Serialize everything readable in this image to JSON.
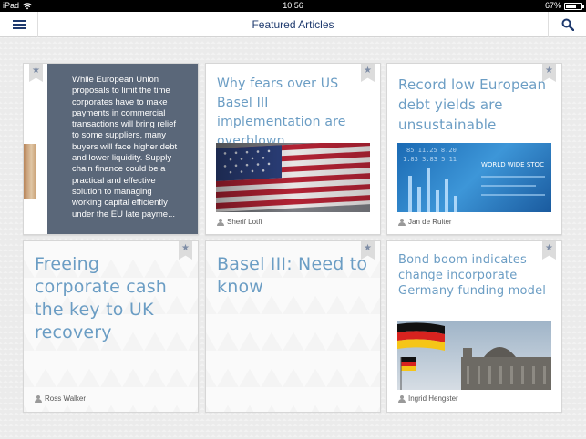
{
  "status": {
    "device": "iPad",
    "time": "10:56",
    "battery": "67%",
    "battery_level": 0.67
  },
  "header": {
    "title": "Featured Articles",
    "menu_icon": "hamburger-icon",
    "search_icon": "search-icon"
  },
  "articles": [
    {
      "summary": "While European Union proposals to limit the time corporates have to make payments in commercial transactions will bring relief to some suppliers, many buyers will face higher debt and lower liquidity. Supply chain finance could be a practical and effective solution to managing working capital efficiently under the EU late payme..."
    },
    {
      "title": "Why fears over US Basel III implementation are overblown",
      "author": "Sherif Lotfi",
      "image": "us-flag"
    },
    {
      "title": "Record low European debt yields are unsustainable",
      "author": "Jan de Ruiter",
      "image": "stock-ticker"
    },
    {
      "title": "Freeing corporate cash the key to UK recovery",
      "author": "Ross Walker"
    },
    {
      "title": "Basel III: Need to know"
    },
    {
      "title": "Bond boom indicates change incorporate Germany funding model",
      "author": "Ingrid Hengster",
      "image": "german-flag-reichstag"
    }
  ],
  "ticker_text": "WORLD WIDE STOC",
  "colors": {
    "accent": "#1e3a6e",
    "title": "#6b9dc4",
    "panel": "#5a6779"
  }
}
